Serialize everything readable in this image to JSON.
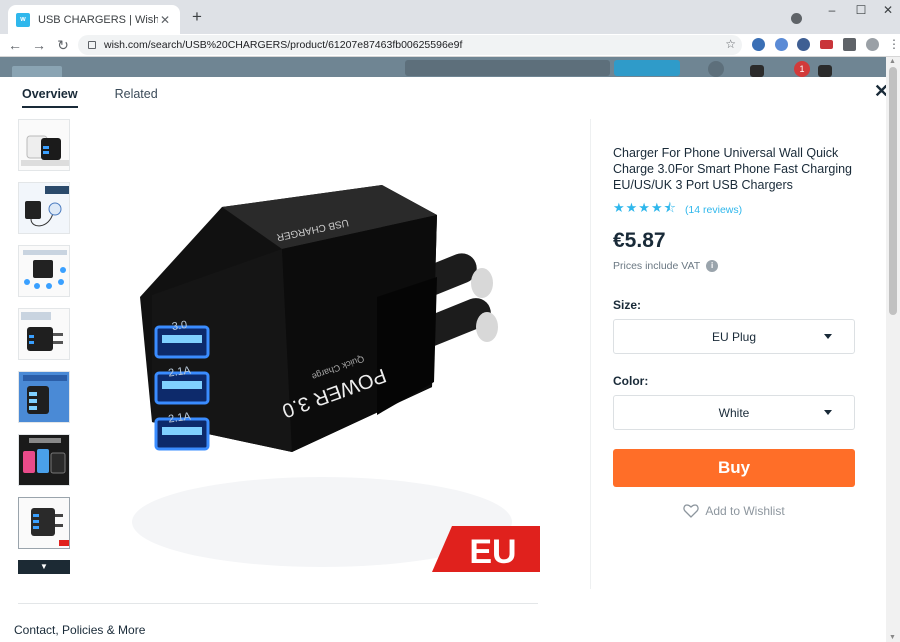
{
  "browser": {
    "tab_title": "USB CHARGERS | Wish",
    "tab_favicon": "w",
    "new_tab_label": "+",
    "url": "wish.com/search/USB%20CHARGERS/product/61207e87463fb00625596e9f",
    "controls": {
      "minimize": "–",
      "maximize": "☐",
      "close": "✕"
    }
  },
  "modal": {
    "tabs": [
      "Overview",
      "Related"
    ],
    "active_tab": "Overview",
    "close_label": "✕",
    "thumbnail_count": 7,
    "more_thumbs_label": "▼",
    "main_image_badge": "EU",
    "main_image_text": {
      "brand": "USB CHARGER",
      "label": "POWER 3.0",
      "subtitle": "Quick Charge",
      "port1": "3.0",
      "port2": "2.1A",
      "port3": "2.1A"
    },
    "bottom_cut_text": "Contact, Policies & More"
  },
  "product": {
    "title": "Charger For Phone Universal Wall Quick Charge 3.0For Smart Phone Fast Charging EU/US/UK 3 Port USB Chargers",
    "rating_stars": "★★★★⯪",
    "rating": 4.5,
    "reviews": "(14 reviews)",
    "price": "€5.87",
    "vat_note": "Prices include VAT",
    "vat_info": "i",
    "size_label": "Size:",
    "size_value": "EU Plug",
    "color_label": "Color:",
    "color_value": "White",
    "buy_label": "Buy",
    "wishlist_label": "Add to Wishlist"
  },
  "colors": {
    "accent_blue": "#2fb7ec",
    "buy_orange": "#ff6e28",
    "text_dark": "#192a38",
    "badge_red": "#e0211d"
  },
  "background_page": {
    "notification_count": "1"
  }
}
